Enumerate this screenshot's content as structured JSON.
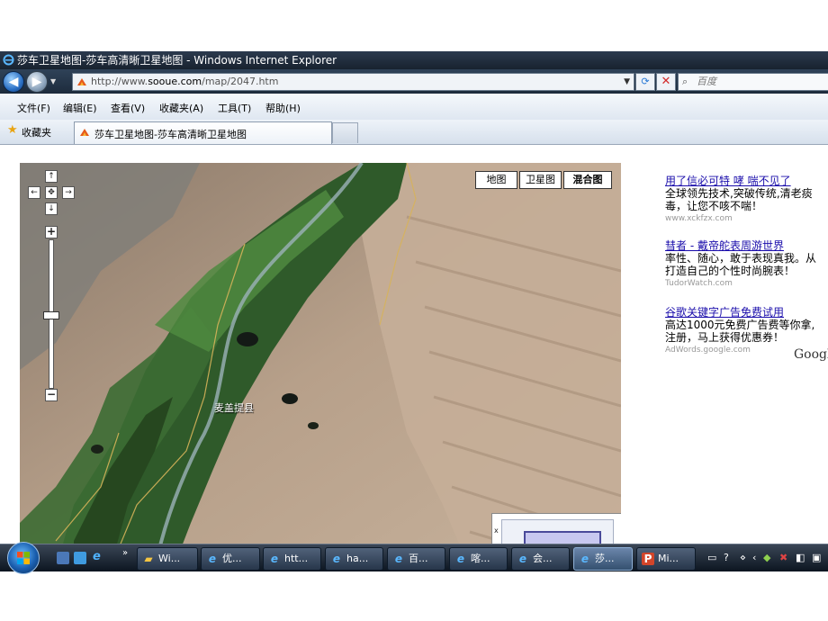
{
  "window": {
    "title": "莎车卫星地图-莎车高清晰卫星地图 - Windows Internet Explorer",
    "icon": "ie-icon"
  },
  "nav": {
    "back_icon": "back-arrow-icon",
    "forward_icon": "forward-arrow-icon",
    "address_prefix": "http://www.",
    "address_domain": "sooue.com",
    "address_path": "/map/2047.htm",
    "search_placeholder": "百度"
  },
  "menu": [
    "文件(F)",
    "编辑(E)",
    "查看(V)",
    "收藏夹(A)",
    "工具(T)",
    "帮助(H)"
  ],
  "favorites": {
    "label": "收藏夹",
    "tab_title": "莎车卫星地图-莎车高清晰卫星地图"
  },
  "map": {
    "type_buttons": [
      "地图",
      "卫星图",
      "混合图"
    ],
    "selected_type": "混合图",
    "pan_labels": {
      "up": "↑",
      "left": "←",
      "center": "✥",
      "right": "→",
      "down": "↓"
    },
    "zoom_in": "+",
    "zoom_out": "−",
    "zoom_level_fraction": 0.5,
    "place_label": "麦盖提县",
    "overview_close": "x"
  },
  "ads": [
    {
      "title": "用了信必可特 哮 喘不见了",
      "body1": "全球领先技术,突破传统,清老痰",
      "body2": "毒，让您不咳不喘！",
      "url": "www.xckfzx.com"
    },
    {
      "title": "彗者 - 戴帝舵表周游世界",
      "body1": "率性、随心，敢于表现真我。从",
      "body2": "打造自己的个性时尚腕表！",
      "url": "TudorWatch.com"
    },
    {
      "title": "谷歌关键字广告免费试用",
      "body1": "高达1000元免费广告费等你拿,",
      "body2": "注册，马上获得优惠券！",
      "url": "AdWords.google.com"
    }
  ],
  "ads_brand": "Googl",
  "taskbar": {
    "quicklaunch_more": "»",
    "items": [
      {
        "label": "Wi...",
        "icon": "folder-icon"
      },
      {
        "label": "优...",
        "icon": "ie-icon"
      },
      {
        "label": "htt...",
        "icon": "ie-icon"
      },
      {
        "label": "ha...",
        "icon": "ie-icon"
      },
      {
        "label": "百...",
        "icon": "ie-icon"
      },
      {
        "label": "喀...",
        "icon": "ie-icon"
      },
      {
        "label": "会...",
        "icon": "ie-icon"
      },
      {
        "label": "莎...",
        "icon": "ie-icon"
      },
      {
        "label": "Mi...",
        "icon": "powerpoint-icon"
      }
    ],
    "active_index": 7
  },
  "colors": {
    "link": "#1a0dab",
    "titlebar": "#1d2b3c",
    "taskbar": "#0c1520",
    "desert": "#b39c84",
    "vegetation": "#2f5a2a"
  }
}
